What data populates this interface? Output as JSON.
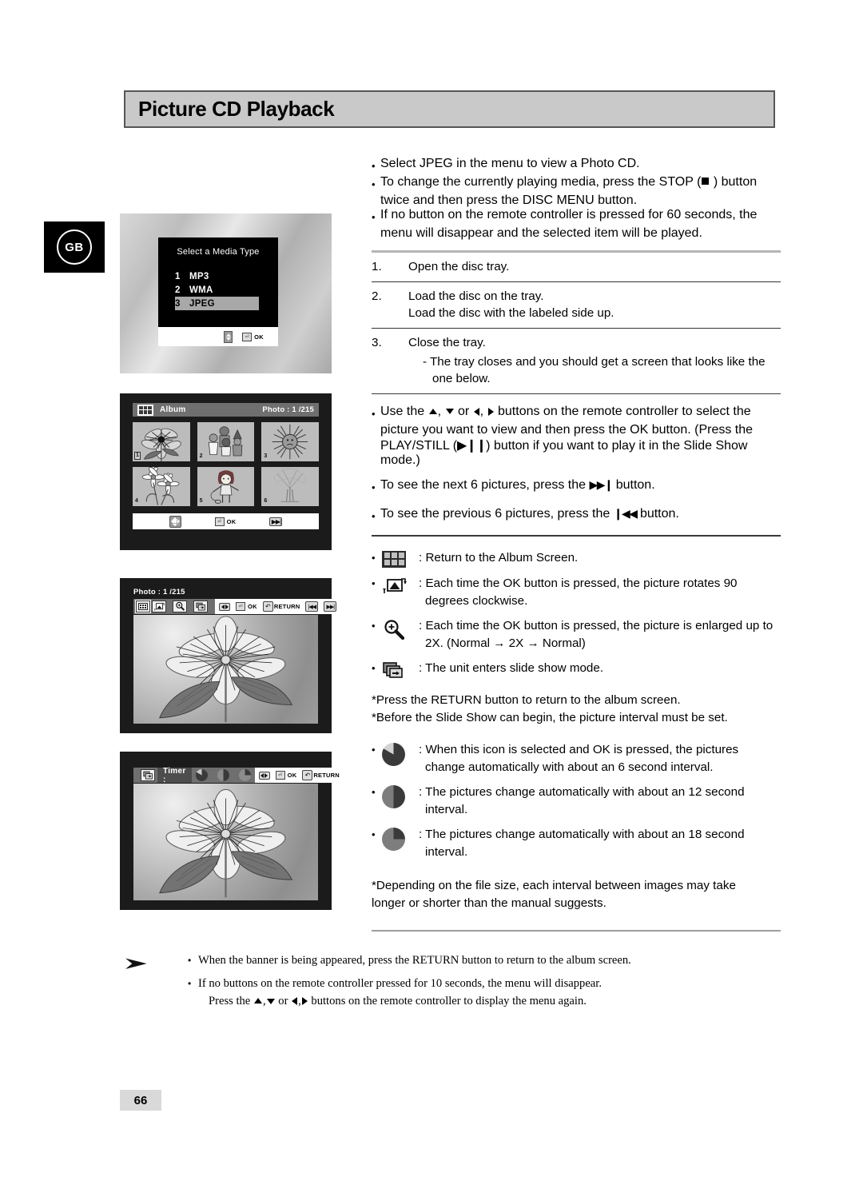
{
  "page": {
    "title": "Picture CD Playback",
    "language_badge": "GB",
    "page_number": "66"
  },
  "intro_bullets": [
    "Select JPEG in the menu to view a Photo CD.",
    "To change the currently playing media, press the STOP (  ) button",
    "twice and then press the DISC MENU button.",
    "If no button on the remote controller is pressed for 60 seconds, the",
    "menu will disappear and the selected item will be played."
  ],
  "steps": [
    {
      "number": "1.",
      "text": "Open the disc tray.",
      "text2": "",
      "dash": ""
    },
    {
      "number": "2.",
      "text": "Load the disc on the tray.",
      "text2": "Load the disc with the labeled side up.",
      "dash": ""
    },
    {
      "number": "3.",
      "text": "Close the tray.",
      "text2": "",
      "dash": "- The tray closes and you should get a screen that looks like the",
      "dash2": "one below."
    }
  ],
  "nav_bullets": {
    "use_line1_pre": "Use the",
    "use_line1_mid": "or",
    "use_line1_post": "buttons on the remote controller to select the",
    "use_line2": "picture you want to view and then press the OK button. (Press the",
    "use_line3_pre": "PLAY/STILL (",
    "use_line3_post": ") button if you want to play it in the Slide Show mode.)",
    "next_pre": "To see the next 6 pictures, press the",
    "next_post": "button.",
    "prev_pre": "To see the previous 6 pictures, press the",
    "prev_post": "button."
  },
  "icon_bullets": [
    {
      "icon": "album-grid-icon",
      "text": "Return to the Album Screen.",
      "text2": ""
    },
    {
      "icon": "rotate-icon",
      "text": "Each time the OK button is pressed, the picture rotates 90",
      "text2": "degrees clockwise."
    },
    {
      "icon": "zoom-icon",
      "text": "Each time the OK button is pressed, the picture is enlarged up to",
      "text2": "2X. (Normal → 2X → Normal)"
    },
    {
      "icon": "slideshow-icon",
      "text": "The unit enters slide show mode.",
      "text2": ""
    }
  ],
  "star_notes_1": [
    "*Press the RETURN button to return to the album screen.",
    "*Before the Slide Show can begin, the picture interval must be set."
  ],
  "timer_bullets": [
    {
      "icon": "timer-6sec-icon",
      "text": "When this icon is selected and OK is pressed, the pictures",
      "text2": "change automatically with about an 6 second interval."
    },
    {
      "icon": "timer-12sec-icon",
      "text": "The pictures change automatically with about an 12 second",
      "text2": "interval."
    },
    {
      "icon": "timer-18sec-icon",
      "text": "The pictures change automatically with about an 18 second",
      "text2": "interval."
    }
  ],
  "star_notes_2": [
    "*Depending on the file size, each interval between images may take",
    " longer or shorter than the manual suggests."
  ],
  "footer_notes": {
    "note1": "When the banner is being appeared, press the RETURN button to return to the album screen.",
    "note2": "If no buttons on the remote controller pressed for 10 seconds, the menu will disappear.",
    "note2_sub_pre": "Press the",
    "note2_sub_mid": "or",
    "note2_sub_post": "buttons on the remote controller to display the menu again."
  },
  "screens": {
    "media_type": {
      "title": "Select a Media Type",
      "options": [
        {
          "num": "1",
          "label": "MP3",
          "selected": false
        },
        {
          "num": "2",
          "label": "WMA",
          "selected": false
        },
        {
          "num": "3",
          "label": "JPEG",
          "selected": true
        }
      ],
      "ok_label": "OK"
    },
    "album": {
      "label": "Album",
      "counter": "Photo : 1  /215",
      "thumbs": [
        {
          "n": "1",
          "art": "flower-dark",
          "selected": true
        },
        {
          "n": "2",
          "art": "characters",
          "selected": false
        },
        {
          "n": "3",
          "art": "sun",
          "selected": false
        },
        {
          "n": "4",
          "art": "daisies",
          "selected": false
        },
        {
          "n": "5",
          "art": "girl",
          "selected": false
        },
        {
          "n": "6",
          "art": "tree",
          "selected": false
        }
      ],
      "ok_label": "OK"
    },
    "photo": {
      "counter": "Photo : 1  /215",
      "ok_label": "OK",
      "return_label": "RETURN"
    },
    "timer": {
      "label": "Timer :",
      "ok_label": "OK",
      "return_label": "RETURN"
    }
  },
  "colors": {
    "banner_bg": "#c9c9c9",
    "banner_border": "#565656",
    "screen_dark": "#1b1b1b",
    "highlight": "#a8a8a8"
  }
}
